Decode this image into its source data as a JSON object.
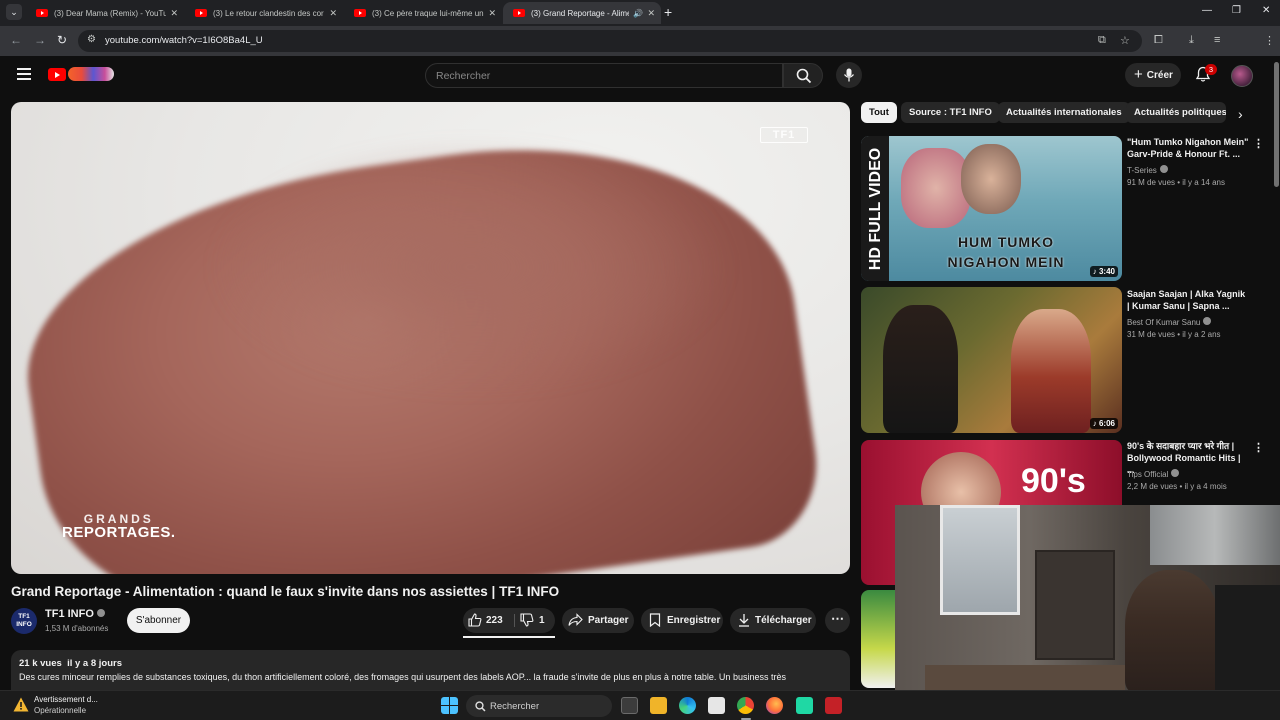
{
  "browser": {
    "tabs": [
      {
        "title": "(3) Dear Mama (Remix) - YouTube",
        "active": false
      },
      {
        "title": "(3) Le retour clandestin des cor",
        "active": false
      },
      {
        "title": "(3) Ce père traque lui-même un",
        "active": false
      },
      {
        "title": "(3) Grand Reportage - Alimentation",
        "active": true
      }
    ],
    "url": "youtube.com/watch?v=1I6O8Ba4L_U"
  },
  "header": {
    "search_placeholder": "Rechercher",
    "create_label": "Créer",
    "notifications": "3"
  },
  "player": {
    "watermark": "TF1",
    "logo_line1": "GRANDS",
    "logo_line2": "REPORTAGES."
  },
  "video": {
    "title": "Grand Reportage - Alimentation : quand le faux s'invite dans nos assiettes | TF1 INFO",
    "channel": "TF1 INFO",
    "channel_logo_text": "TF1 INFO",
    "subscribers": "1,53 M d'abonnés",
    "subscribe_label": "S'abonner",
    "likes": "223",
    "dislikes": "1",
    "share_label": "Partager",
    "save_label": "Enregistrer",
    "download_label": "Télécharger",
    "views": "21 k vues",
    "age": "il y a 8 jours",
    "description": "Des cures minceur remplies de substances toxiques, du thon artificiellement coloré, des fromages qui usurpent des labels AOP... la fraude s'invite de plus en plus à notre table. Un business très"
  },
  "chips": [
    "Tout",
    "Source : TF1 INFO",
    "Actualités internationales",
    "Actualités politiques"
  ],
  "recommendations": [
    {
      "title": "\"Hum Tumko Nigahon Mein\" Garv-Pride & Honour Ft. ...",
      "channel": "T-Series",
      "views": "91 M de vues",
      "age": "il y a 14 ans",
      "duration": "3:40",
      "thumb_text_1": "HUM TUMKO",
      "thumb_text_2": "NIGAHON MEIN",
      "thumb_side_text": "HD FULL VIDEO"
    },
    {
      "title": "Saajan Saajan | Alka Yagnik | Kumar Sanu | Sapna ...",
      "channel": "Best Of Kumar Sanu",
      "views": "31 M de vues",
      "age": "il y a 2 ans",
      "duration": "6:06"
    },
    {
      "title": "90's के सदाबहार प्यार भरे गीत | Bollywood Romantic Hits | ...",
      "channel": "Tips Official",
      "views": "2,2 M de vues",
      "age": "il y a 4 mois",
      "thumb_text": "90's"
    }
  ],
  "taskbar": {
    "warning_title": "Avertissement d...",
    "warning_status": "Opérationnelle",
    "search_label": "Rechercher"
  }
}
